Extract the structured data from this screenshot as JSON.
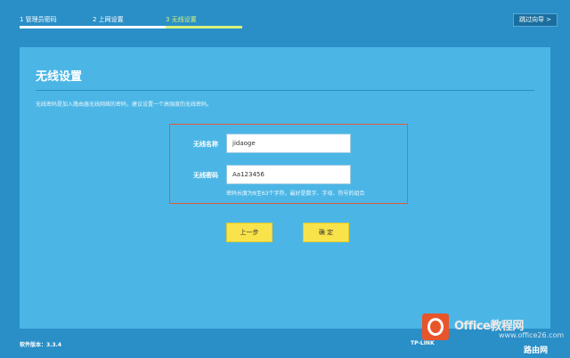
{
  "steps": [
    {
      "label": "1 管理员密码",
      "active": false
    },
    {
      "label": "2 上网设置",
      "active": false
    },
    {
      "label": "3 无线设置",
      "active": true
    }
  ],
  "skip_label": "跳过向导 >",
  "panel": {
    "title": "无线设置",
    "description": "无线密码是加入路由器无线网络的密码，建议设置一个高强度的无线密码。"
  },
  "form": {
    "ssid_label": "无线名称",
    "ssid_value": "jidaoge",
    "password_label": "无线密码",
    "password_value": "Aa123456",
    "hint": "密码长度为8至63个字符，最好是数字、字母、符号的组合"
  },
  "buttons": {
    "prev": "上一步",
    "ok": "确 定"
  },
  "footer": {
    "version": "软件版本：3.3.4",
    "brand": "TP-LINK"
  },
  "watermark": {
    "text1": "Office教程网",
    "text2": "www.office26.com",
    "text3": "路由网"
  },
  "colors": {
    "background": "#2a8fc7",
    "panel": "#4bb6e6",
    "active_step": "#d7f27a",
    "button": "#f8e34a",
    "highlight_border": "#e15a3a"
  }
}
